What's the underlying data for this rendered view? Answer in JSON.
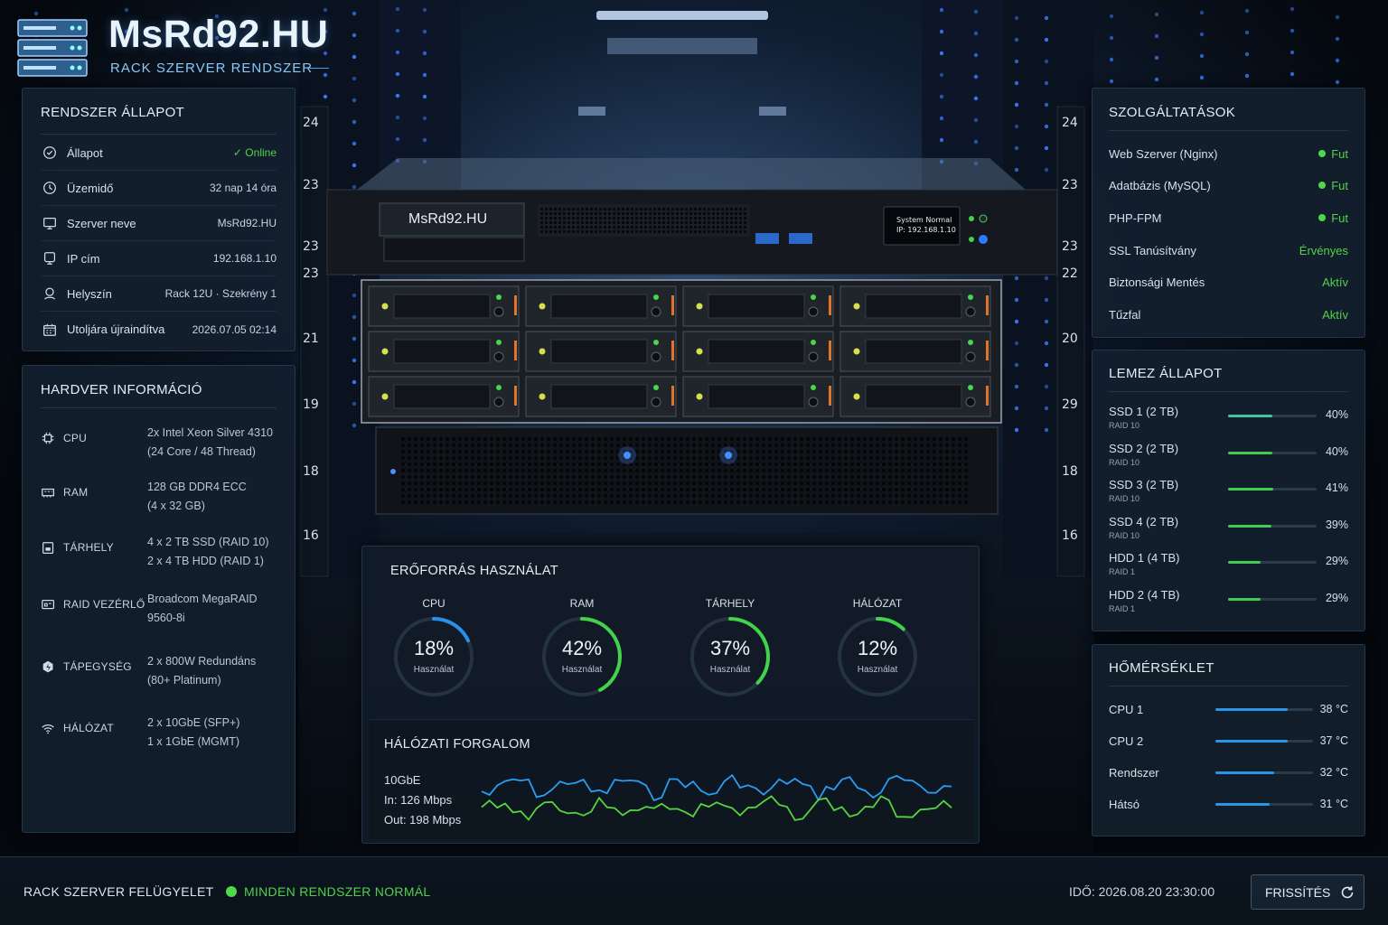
{
  "header": {
    "title": "MsRd92.HU",
    "subtitle": "RACK SZERVER RENDSZER"
  },
  "status_panel": {
    "title": "RENDSZER ÁLLAPOT",
    "rows": [
      {
        "icon": "check-circle-icon",
        "label": "Állapot",
        "value": "✓ Online"
      },
      {
        "icon": "clock-icon",
        "label": "Üzemidő",
        "value": "32 nap 14 óra"
      },
      {
        "icon": "monitor-icon",
        "label": "Szerver neve",
        "value": "MsRd92.HU"
      },
      {
        "icon": "ip-icon",
        "label": "IP cím",
        "value": "192.168.1.10"
      },
      {
        "icon": "location-icon",
        "label": "Helyszín",
        "value": "Rack 12U · Szekrény 1"
      },
      {
        "icon": "calendar-icon",
        "label": "Utoljára újraindítva",
        "value": "2026.07.05 02:14"
      }
    ]
  },
  "hardware_panel": {
    "title": "HARDVER INFORMÁCIÓ",
    "rows": [
      {
        "icon": "cpu-icon",
        "label": "CPU",
        "line1": "2x Intel Xeon Silver 4310",
        "line2": "(24 Core / 48 Thread)"
      },
      {
        "icon": "ram-icon",
        "label": "RAM",
        "line1": "128 GB DDR4 ECC",
        "line2": "(4 x 32 GB)"
      },
      {
        "icon": "storage-icon",
        "label": "TÁRHELY",
        "line1": "4 x 2 TB SSD (RAID 10)",
        "line2": "2 x 4 TB HDD (RAID 1)"
      },
      {
        "icon": "raid-controller-icon",
        "label": "RAID VEZÉRLŐ",
        "line1": "Broadcom MegaRAID",
        "line2": "9560-8i"
      },
      {
        "icon": "power-supply-icon",
        "label": "TÁPEGYSÉG",
        "line1": "2 x 800W Redundáns",
        "line2": "(80+ Platinum)"
      },
      {
        "icon": "network-icon",
        "label": "HÁLÓZAT",
        "line1": "2 x 10GbE (SFP+)",
        "line2": "1 x 1GbE (MGMT)"
      }
    ]
  },
  "server": {
    "name_plate": "MsRd92.HU",
    "lcd_line1": "System Normal",
    "lcd_line2": "IP: 192.168.1.10",
    "rack_units_left": [
      "24",
      "23",
      "23",
      "23",
      "21",
      "19",
      "18",
      "16"
    ],
    "rack_units_right": [
      "24",
      "23",
      "23",
      "22",
      "20",
      "29",
      "18",
      "16"
    ]
  },
  "resources": {
    "title": "ERŐFORRÁS HASZNÁLAT",
    "gauges": [
      {
        "label": "CPU",
        "percent": 18,
        "display": "18%",
        "sub": "Használat",
        "color": "#2a8fe6"
      },
      {
        "label": "RAM",
        "percent": 42,
        "display": "42%",
        "sub": "Használat",
        "color": "#43d34a"
      },
      {
        "label": "TÁRHELY",
        "percent": 37,
        "display": "37%",
        "sub": "Használat",
        "color": "#43d34a"
      },
      {
        "label": "HÁLÓZAT",
        "percent": 12,
        "display": "12%",
        "sub": "Használat",
        "color": "#43d34a"
      }
    ]
  },
  "network_traffic": {
    "title": "HÁLÓZATI FORGALOM",
    "iface": "10GbE",
    "in": "In: 126 Mbps",
    "out": "Out: 198 Mbps",
    "colors": {
      "in": "#2a9df0",
      "out": "#55d43f"
    }
  },
  "services_panel": {
    "title": "SZOLGÁLTATÁSOK",
    "rows": [
      {
        "label": "Web Szerver (Nginx)",
        "value": "Fut",
        "dot": true
      },
      {
        "label": "Adatbázis (MySQL)",
        "value": "Fut",
        "dot": true
      },
      {
        "label": "PHP-FPM",
        "value": "Fut",
        "dot": true
      },
      {
        "label": "SSL Tanúsítvány",
        "value": "Érvényes",
        "dot": false
      },
      {
        "label": "Biztonsági Mentés",
        "value": "Aktív",
        "dot": false
      },
      {
        "label": "Tűzfal",
        "value": "Aktív",
        "dot": false
      }
    ]
  },
  "disks_panel": {
    "title": "LEMEZ ÁLLAPOT",
    "disks": [
      {
        "name": "SSD 1 (2 TB)",
        "raid": "RAID 10",
        "percent": 40,
        "display": "40%",
        "color": "#3fc7a0"
      },
      {
        "name": "SSD 2 (2 TB)",
        "raid": "RAID 10",
        "percent": 40,
        "display": "40%",
        "color": "#3fcc50"
      },
      {
        "name": "SSD 3 (2 TB)",
        "raid": "RAID 10",
        "percent": 41,
        "display": "41%",
        "color": "#3fcc50"
      },
      {
        "name": "SSD 4 (2 TB)",
        "raid": "RAID 10",
        "percent": 39,
        "display": "39%",
        "color": "#3fcc50"
      },
      {
        "name": "HDD 1 (4 TB)",
        "raid": "RAID 1",
        "percent": 29,
        "display": "29%",
        "color": "#3fcc50"
      },
      {
        "name": "HDD 2 (4 TB)",
        "raid": "RAID 1",
        "percent": 29,
        "display": "29%",
        "color": "#3fcc50"
      }
    ]
  },
  "temps_panel": {
    "title": "HŐMÉRSÉKLET",
    "rows": [
      {
        "name": "CPU 1",
        "value": "38 °C",
        "level": 0.74
      },
      {
        "name": "CPU 2",
        "value": "37 °C",
        "level": 0.74
      },
      {
        "name": "Rendszer",
        "value": "32 °C",
        "level": 0.6
      },
      {
        "name": "Hátsó",
        "value": "31 °C",
        "level": 0.56
      }
    ]
  },
  "footer": {
    "left": "RACK SZERVER FELÜGYELET",
    "status": "MINDEN RENDSZER NORMÁL",
    "time": "IDŐ: 2026.08.20 23:30:00",
    "refresh": "FRISSÍTÉS"
  }
}
